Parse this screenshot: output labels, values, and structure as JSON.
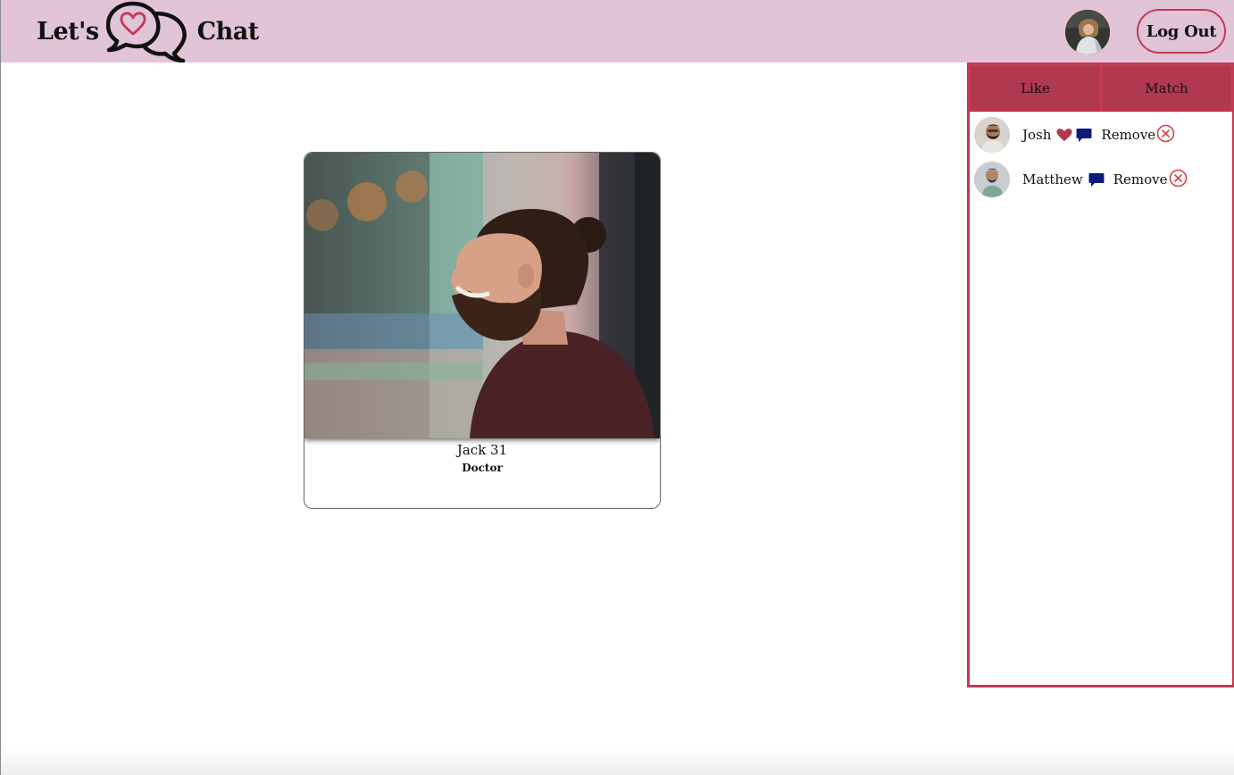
{
  "header": {
    "brand_left": "Let's",
    "brand_right": "Chat",
    "logout_label": "Log Out"
  },
  "card": {
    "name_age": "Jack 31",
    "occupation": "Doctor"
  },
  "panel": {
    "tabs": [
      {
        "label": "Like"
      },
      {
        "label": "Match"
      }
    ],
    "items": [
      {
        "name": "Josh",
        "icons": [
          "heart-icon",
          "chat-icon"
        ],
        "remove_label": "Remove"
      },
      {
        "name": "Matthew",
        "icons": [
          "chat-icon"
        ],
        "remove_label": "Remove"
      }
    ]
  },
  "colors": {
    "header_bg": "#e1c4d8",
    "accent": "#c23a55",
    "tab_bg": "#b0394f",
    "heart": "#b0394f",
    "chat": "#0d1a7a"
  }
}
